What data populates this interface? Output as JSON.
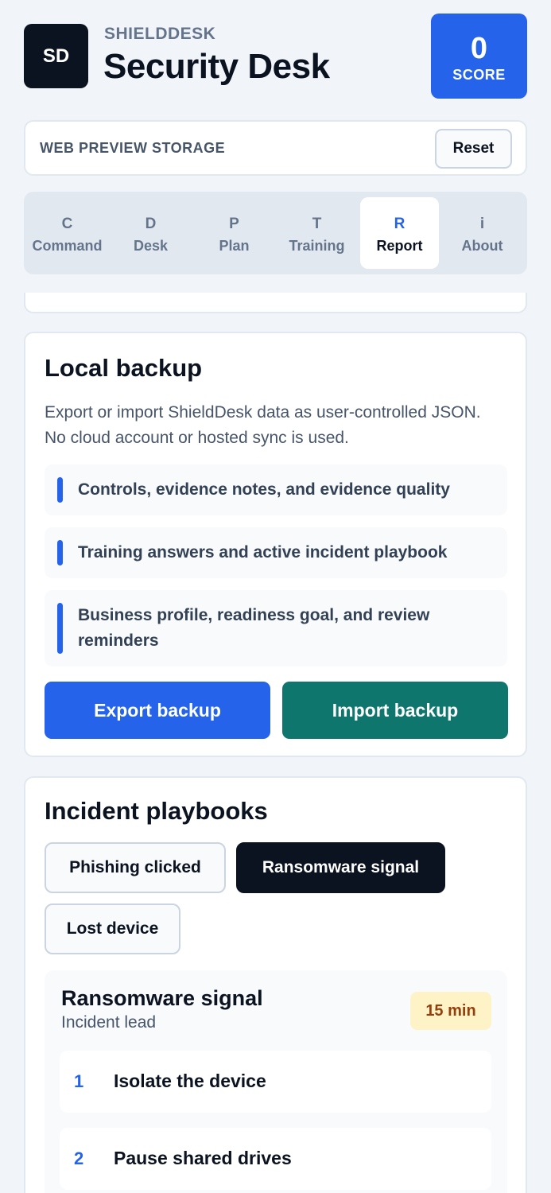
{
  "header": {
    "logo": "SD",
    "brand": "SHIELDDESK",
    "title": "Security Desk",
    "score_value": "0",
    "score_label": "SCORE"
  },
  "storage": {
    "label": "WEB PREVIEW STORAGE",
    "reset_label": "Reset"
  },
  "tabs": [
    {
      "letter": "C",
      "label": "Command"
    },
    {
      "letter": "D",
      "label": "Desk"
    },
    {
      "letter": "P",
      "label": "Plan"
    },
    {
      "letter": "T",
      "label": "Training"
    },
    {
      "letter": "R",
      "label": "Report",
      "active": true
    },
    {
      "letter": "i",
      "label": "About"
    }
  ],
  "backup": {
    "title": "Local backup",
    "description": "Export or import ShieldDesk data as user-controlled JSON. No cloud account or hosted sync is used.",
    "items": [
      "Controls, evidence notes, and evidence quality",
      "Training answers and active incident playbook",
      "Business profile, readiness goal, and review reminders"
    ],
    "export_label": "Export backup",
    "import_label": "Import backup"
  },
  "playbooks": {
    "title": "Incident playbooks",
    "options": [
      "Phishing clicked",
      "Ransomware signal",
      "Lost device"
    ],
    "selected": "Ransomware signal",
    "active": {
      "title": "Ransomware signal",
      "role": "Incident lead",
      "duration": "15 min",
      "steps": [
        {
          "num": "1",
          "text": "Isolate the device"
        },
        {
          "num": "2",
          "text": "Pause shared drives"
        }
      ]
    }
  },
  "colors": {
    "accent": "#2563eb",
    "dark": "#0b1220",
    "import": "#0f766e",
    "badge_bg": "#fef3c7",
    "badge_text": "#92400e"
  }
}
